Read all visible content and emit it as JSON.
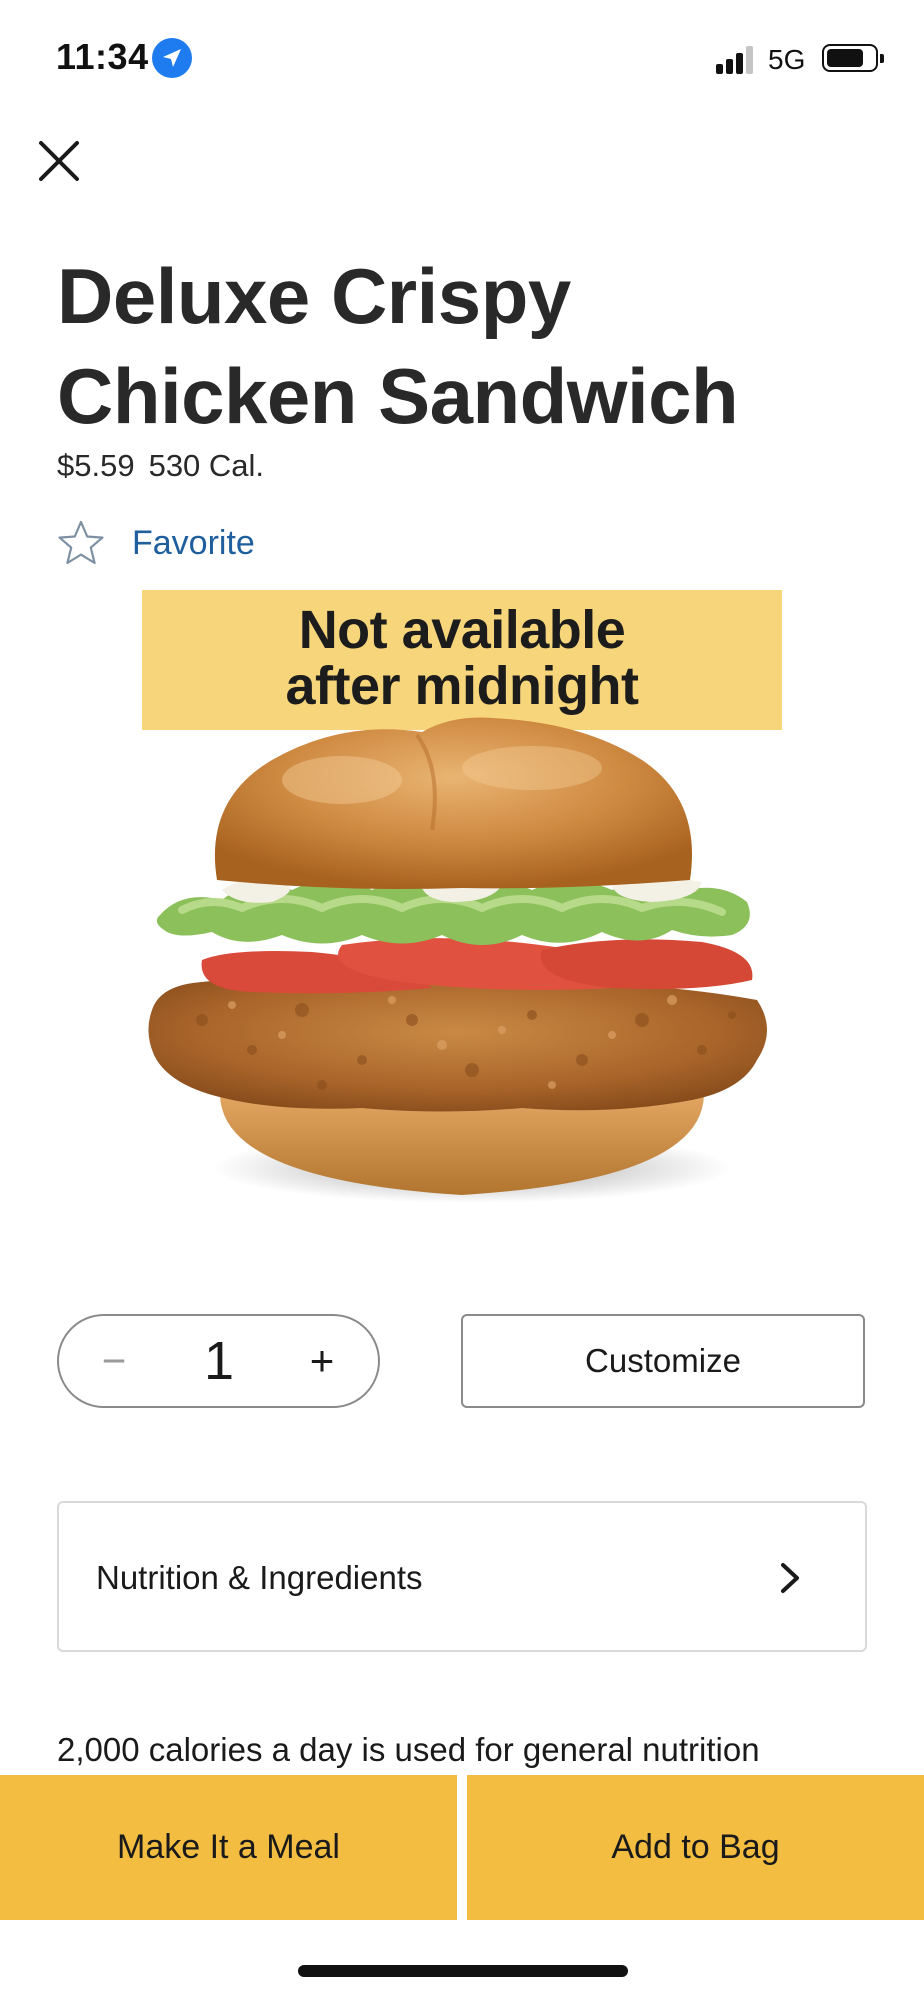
{
  "status_bar": {
    "time": "11:34",
    "network": "5G",
    "location_icon": "location-arrow-icon",
    "signal_icon": "cellular-signal-icon",
    "battery_icon": "battery-icon",
    "signal_bars_active": 3,
    "signal_bars_total": 4,
    "battery_level": 0.8
  },
  "header": {
    "close_icon": "close-icon"
  },
  "product": {
    "title_line1": "Deluxe Crispy",
    "title_line2": "Chicken Sandwich",
    "price": "$5.59",
    "calories": "530 Cal.",
    "favorite_label": "Favorite",
    "favorite_icon": "star-outline-icon",
    "image_banner_line1": "Not available",
    "image_banner_line2": "after midnight",
    "image_subject": "sandwich-image"
  },
  "order": {
    "quantity": "1",
    "minus_label": "−",
    "plus_label": "+",
    "customize_label": "Customize"
  },
  "nutrition": {
    "label": "Nutrition & Ingredients",
    "chevron_icon": "chevron-right-icon"
  },
  "disclaimer": "2,000 calories a day is used for general nutrition",
  "actions": {
    "meal_label": "Make It a Meal",
    "bag_label": "Add to Bag"
  },
  "colors": {
    "accent_yellow": "#f2bd41",
    "banner_yellow": "#f7d57b",
    "link_blue": "#1f5f9e",
    "location_blue": "#1f7bf0",
    "text_dark": "#292929"
  }
}
